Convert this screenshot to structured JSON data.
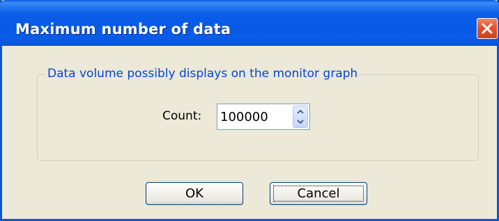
{
  "window": {
    "title": "Maximum number of data",
    "close_icon": "close-icon"
  },
  "group": {
    "title": "Data volume possibly displays on the monitor graph"
  },
  "count": {
    "label": "Count:",
    "value": "100000"
  },
  "buttons": {
    "ok_label": "OK",
    "cancel_label": "Cancel"
  },
  "colors": {
    "titlebar": "#0a5ce8",
    "group_title": "#0046d5",
    "close_button": "#e0532e",
    "background": "#ece9d8"
  }
}
